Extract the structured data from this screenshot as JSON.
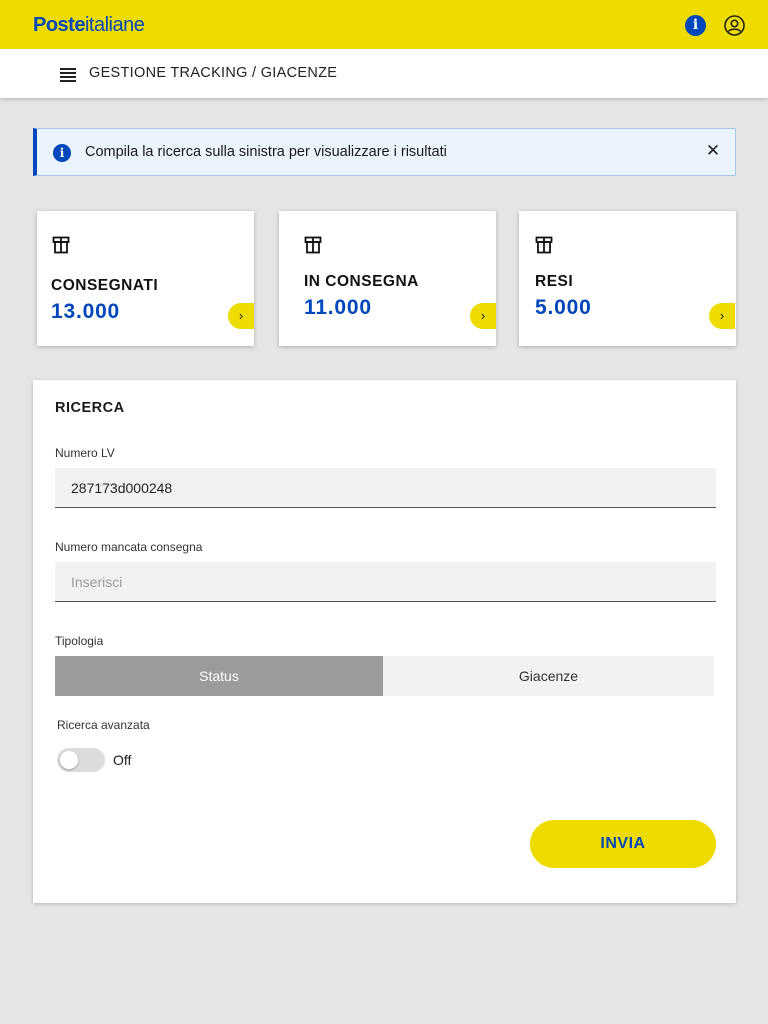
{
  "header": {
    "logo_bold": "Poste",
    "logo_light": "italiane",
    "info_icon": "info-icon",
    "user_icon": "user-icon"
  },
  "subheader": {
    "menu_icon": "hamburger-menu-icon",
    "title": "GESTIONE TRACKING / GIACENZE"
  },
  "alert": {
    "text": "Compila la ricerca sulla sinistra per visualizzare i risultati",
    "close": "✕"
  },
  "cards": [
    {
      "label": "CONSEGNATI",
      "value": "13.000",
      "icon": "package-icon"
    },
    {
      "label": "IN CONSEGNA",
      "value": "11.000",
      "icon": "package-icon"
    },
    {
      "label": "RESI",
      "value": "5.000",
      "icon": "package-icon"
    }
  ],
  "search": {
    "title": "RICERCA",
    "numero_lv_label": "Numero LV",
    "numero_lv_value": "287173d000248",
    "mancata_label": "Numero mancata consegna",
    "mancata_placeholder": "Inserisci",
    "tipologia_label": "Tipologia",
    "tipologia_options": [
      "Status",
      "Giacenze"
    ],
    "tipologia_selected": "Status",
    "avanzata_label": "Ricerca avanzata",
    "avanzata_state": "Off",
    "submit_label": "INVIA"
  },
  "colors": {
    "brand_yellow": "#eedc00",
    "brand_blue": "#0047bb"
  }
}
